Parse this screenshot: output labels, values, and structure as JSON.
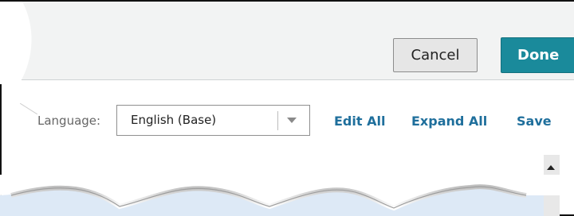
{
  "header": {
    "cancel_label": "Cancel",
    "done_label": "Done"
  },
  "toolbar": {
    "language_label": "Language:",
    "language_value": "English (Base)",
    "edit_all_label": "Edit All",
    "expand_all_label": "Expand All",
    "save_label": "Save"
  },
  "colors": {
    "header_background": "#f2f3f3",
    "done_button": "#1a8a9b",
    "link": "#1f6f9c",
    "selected_row": "#dde9f6"
  },
  "icons": {
    "language_dropdown": "chevron-down-icon",
    "scroll_up": "arrow-up-icon"
  }
}
